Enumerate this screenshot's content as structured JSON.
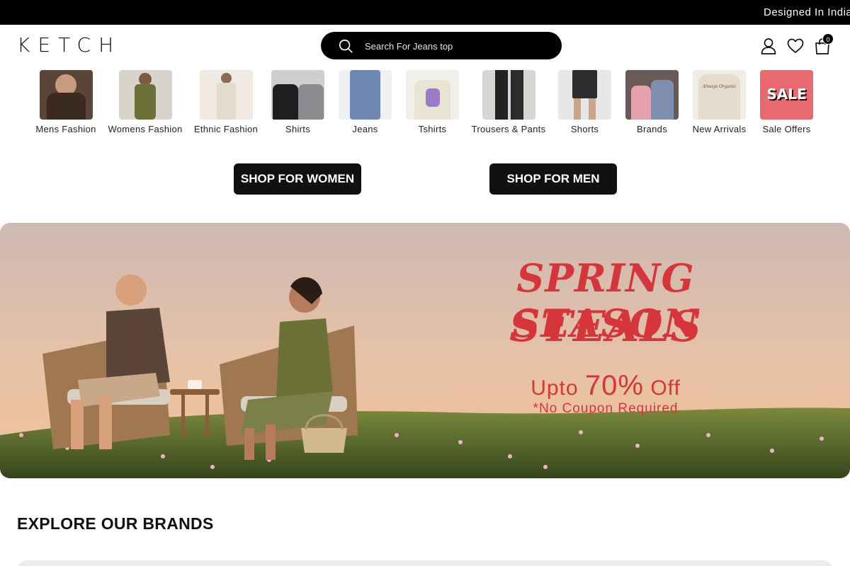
{
  "announcement": "Designed In India",
  "header": {
    "logo": "KETCH",
    "search_placeholder": "Search For Jeans top",
    "cart_count": "0"
  },
  "categories": [
    {
      "label": "Mens Fashion",
      "color": "#5b4538"
    },
    {
      "label": "Womens Fashion",
      "color": "#6b7036"
    },
    {
      "label": "Ethnic Fashion",
      "color": "#e4dbcf"
    },
    {
      "label": "Shirts",
      "color": "#3c3c3e"
    },
    {
      "label": "Jeans",
      "color": "#6f87b3"
    },
    {
      "label": "Tshirts",
      "color": "#e9e3d3"
    },
    {
      "label": "Trousers & Pants",
      "color": "#2a2a2a"
    },
    {
      "label": "Shorts",
      "color": "#4a4a4c"
    },
    {
      "label": "Brands",
      "color": "#7f8fae"
    },
    {
      "label": "New Arrivals",
      "color": "#e6dccd"
    },
    {
      "label": "Sale Offers",
      "color": "#e86a6e"
    }
  ],
  "sale_tile_text": "SALE",
  "tile_text_tshirt": "Always Organic",
  "shop_buttons": {
    "women": "SHOP FOR WOMEN",
    "men": "SHOP FOR MEN"
  },
  "banner": {
    "line1": "SPRING SEASON",
    "line2": "STEALS",
    "discount_prefix": "Upto ",
    "discount_value": "70%",
    "discount_suffix": " Off",
    "note": "*No Coupon Required",
    "accent_color": "#d6353c"
  },
  "section_title": "EXPLORE OUR BRANDS"
}
